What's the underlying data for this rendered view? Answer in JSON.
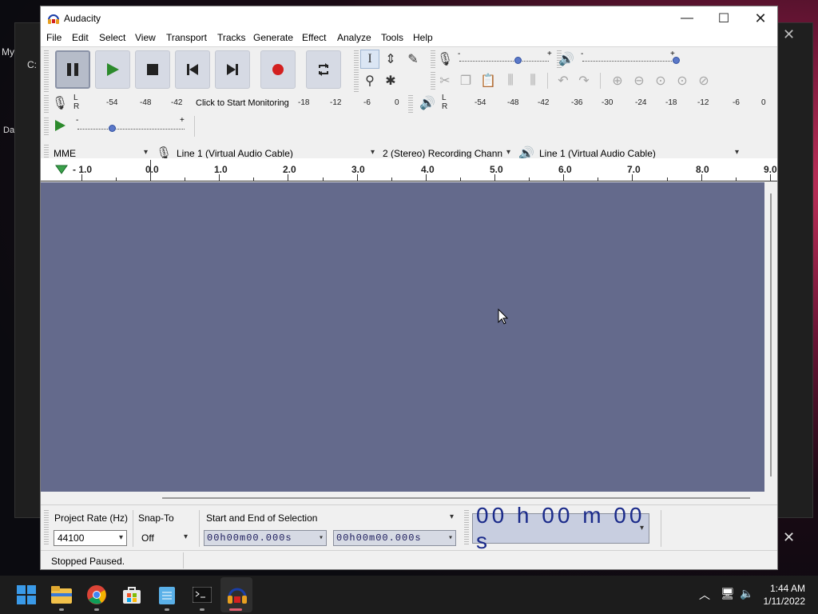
{
  "window": {
    "title": "Audacity"
  },
  "menu": [
    "File",
    "Edit",
    "Select",
    "View",
    "Transport",
    "Tracks",
    "Generate",
    "Effect",
    "Analyze",
    "Tools",
    "Help"
  ],
  "meters": {
    "record_ticks": [
      "-54",
      "-48",
      "-42",
      "-18",
      "-12",
      "-6",
      "0"
    ],
    "monitor_label": "Click to Start Monitoring",
    "playback_ticks": [
      "-54",
      "-48",
      "-42",
      "-36",
      "-30",
      "-24",
      "-18",
      "-12",
      "-6",
      "0"
    ],
    "lr": [
      "L",
      "R"
    ]
  },
  "device": {
    "host": "MME",
    "input": "Line 1 (Virtual Audio Cable)",
    "channels": "2 (Stereo) Recording Chann",
    "output": "Line 1 (Virtual Audio Cable)"
  },
  "ruler": [
    "- 1.0",
    "0.0",
    "1.0",
    "2.0",
    "3.0",
    "4.0",
    "5.0",
    "6.0",
    "7.0",
    "8.0",
    "9.0"
  ],
  "selection": {
    "rate_label": "Project Rate (Hz)",
    "rate_value": "44100",
    "snap_label": "Snap-To",
    "snap_value": "Off",
    "mode": "Start and End of Selection",
    "start": "00h00m00.000s",
    "end": "00h00m00.000s",
    "audio_position": "00 h 00 m 00 s"
  },
  "status": "Stopped Paused.",
  "taskbar": {
    "time": "1:44 AM",
    "date": "1/11/2022"
  },
  "desktop": {
    "left_labels": [
      "My",
      "C:",
      "Da"
    ]
  },
  "colors": {
    "track_bg": "#646a8c",
    "button": "#d6dae4",
    "record": "#d32020",
    "play": "#2c8a2c"
  }
}
